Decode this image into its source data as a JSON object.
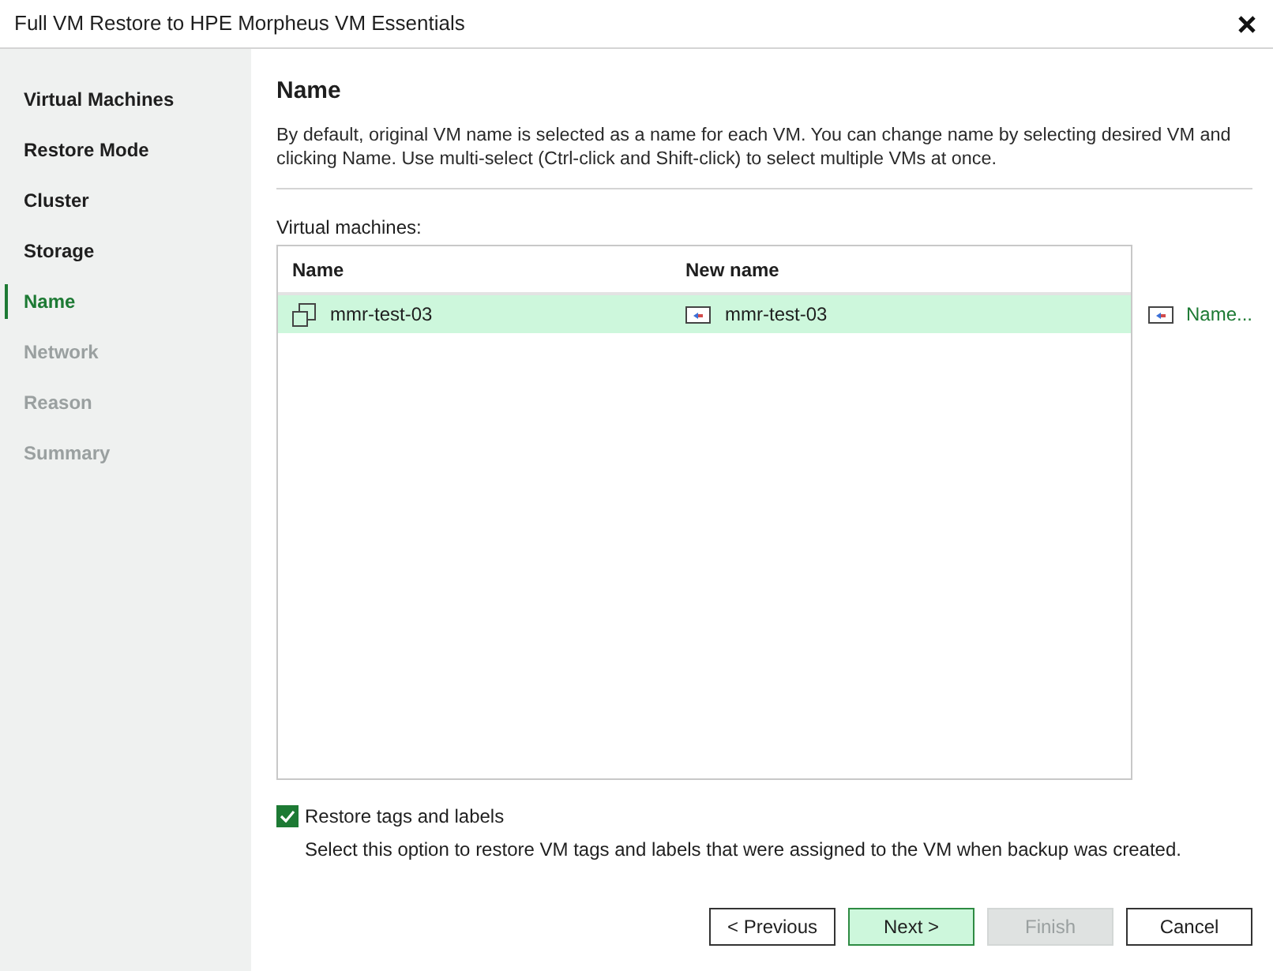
{
  "window": {
    "title": "Full VM Restore to HPE Morpheus VM Essentials"
  },
  "steps": [
    {
      "label": "Virtual Machines",
      "selected": false,
      "disabled": false
    },
    {
      "label": "Restore Mode",
      "selected": false,
      "disabled": false
    },
    {
      "label": "Cluster",
      "selected": false,
      "disabled": false
    },
    {
      "label": "Storage",
      "selected": false,
      "disabled": false
    },
    {
      "label": "Name",
      "selected": true,
      "disabled": false
    },
    {
      "label": "Network",
      "selected": false,
      "disabled": true
    },
    {
      "label": "Reason",
      "selected": false,
      "disabled": true
    },
    {
      "label": "Summary",
      "selected": false,
      "disabled": true
    }
  ],
  "page": {
    "heading": "Name",
    "description": "By default, original VM name is selected as a name for each VM. You can change name by selecting desired VM and clicking Name. Use multi-select (Ctrl-click and Shift-click) to select multiple VMs at once."
  },
  "table": {
    "label": "Virtual machines:",
    "columns": [
      "Name",
      "New name"
    ],
    "rows": [
      {
        "name": "mmr-test-03",
        "new_name": "mmr-test-03",
        "selected": true
      }
    ]
  },
  "side_action": {
    "label": "Name..."
  },
  "option": {
    "label": "Restore tags and labels",
    "checked": true,
    "description": "Select this option to restore VM tags and labels that were assigned to the VM when backup was created."
  },
  "buttons": [
    {
      "label": "< Previous",
      "kind": "normal",
      "disabled": false
    },
    {
      "label": "Next >",
      "kind": "default",
      "disabled": false
    },
    {
      "label": "Finish",
      "kind": "normal",
      "disabled": true
    },
    {
      "label": "Cancel",
      "kind": "normal",
      "disabled": false
    }
  ]
}
